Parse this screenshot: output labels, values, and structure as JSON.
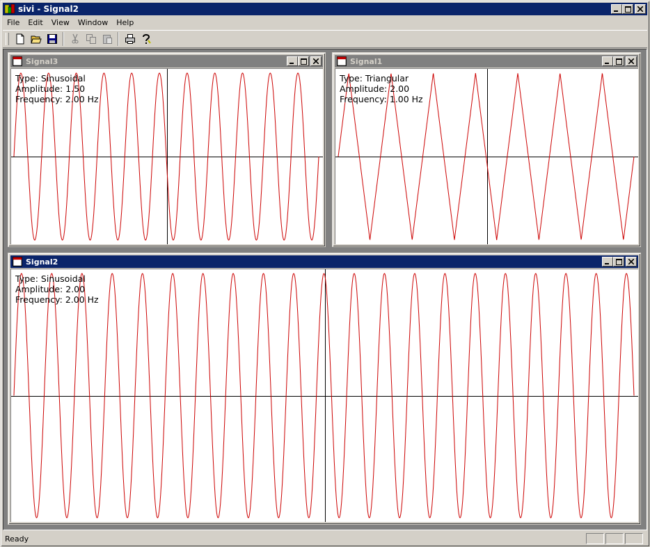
{
  "app": {
    "title": "sivi - Signal2",
    "status_text": "Ready"
  },
  "menu": [
    "File",
    "Edit",
    "View",
    "Window",
    "Help"
  ],
  "toolbar": {
    "buttons": [
      {
        "icon": "new-file-icon",
        "enabled": true
      },
      {
        "icon": "open-folder-icon",
        "enabled": true
      },
      {
        "icon": "save-icon",
        "enabled": true
      },
      {
        "icon": "cut-icon",
        "enabled": false
      },
      {
        "icon": "copy-icon",
        "enabled": false
      },
      {
        "icon": "paste-icon",
        "enabled": false
      },
      {
        "icon": "print-icon",
        "enabled": true
      },
      {
        "icon": "help-icon",
        "enabled": true
      }
    ]
  },
  "windows": [
    {
      "id": "signal3",
      "title": "Signal3",
      "active": false,
      "type_label": "Type: Sinusoidal",
      "amplitude_label": "Amplitude: 1.50",
      "frequency_label": "Frequency: 2.00 Hz",
      "signal": {
        "type": "sinusoidal",
        "amplitude": 1.5,
        "frequency": 2.0,
        "cycles_shown": 11
      }
    },
    {
      "id": "signal1",
      "title": "Signal1",
      "active": false,
      "type_label": "Type: Triangular",
      "amplitude_label": "Amplitude: 2.00",
      "frequency_label": "Frequency: 1.00 Hz",
      "signal": {
        "type": "triangular",
        "amplitude": 2.0,
        "frequency": 1.0,
        "cycles_shown": 7
      }
    },
    {
      "id": "signal2",
      "title": "Signal2",
      "active": true,
      "type_label": "Type: Sinusoidal",
      "amplitude_label": "Amplitude: 2.00",
      "frequency_label": "Frequency: 2.00 Hz",
      "signal": {
        "type": "sinusoidal",
        "amplitude": 2.0,
        "frequency": 2.0,
        "cycles_shown": 20.5
      }
    }
  ],
  "colors": {
    "active_title": "#0a246a",
    "inactive_title": "#808080",
    "signal": "#cc0000",
    "axis": "#000000",
    "face": "#d4d0c8"
  }
}
